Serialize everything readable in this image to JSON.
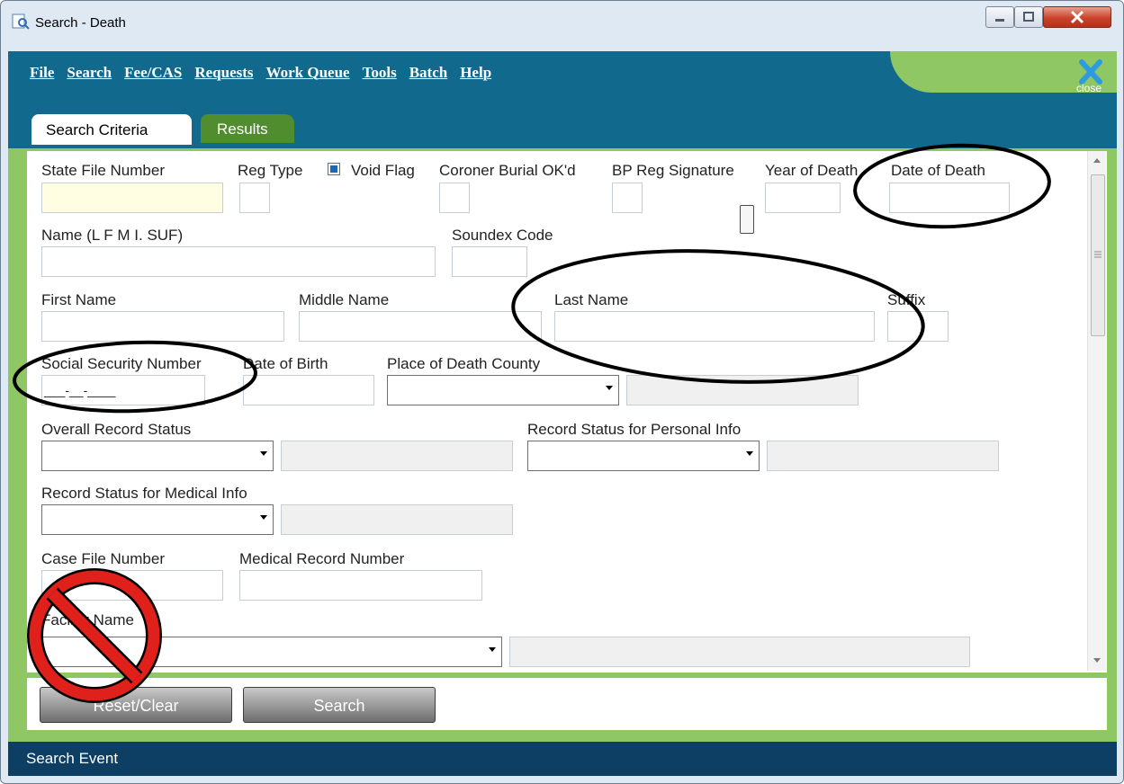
{
  "window": {
    "title": "Search - Death",
    "close_label": "close"
  },
  "menu": [
    {
      "label": "File"
    },
    {
      "label": "Search"
    },
    {
      "label": "Fee/CAS"
    },
    {
      "label": "Requests"
    },
    {
      "label": "Work Queue"
    },
    {
      "label": "Tools"
    },
    {
      "label": "Batch"
    },
    {
      "label": "Help"
    }
  ],
  "tabs": {
    "criteria": "Search Criteria",
    "results": "Results"
  },
  "form": {
    "state_file_number": "State File Number",
    "reg_type": "Reg Type",
    "void_flag": "Void Flag",
    "coroner_burial": "Coroner Burial OK'd",
    "bp_reg_signature": "BP Reg Signature",
    "year_of_death": "Year of Death",
    "date_of_death": "Date of Death",
    "name_full": "Name (L  F M I. SUF)",
    "soundex_code": "Soundex Code",
    "first_name": "First Name",
    "middle_name": "Middle Name",
    "last_name": "Last Name",
    "suffix": "Suffix",
    "ssn": "Social Security Number",
    "ssn_mask": "___-__-____",
    "date_of_birth": "Date of Birth",
    "place_of_death_county": "Place of Death County",
    "overall_record_status": "Overall Record Status",
    "record_status_personal": "Record Status for Personal Info",
    "record_status_medical": "Record Status for Medical Info",
    "case_file_number": "Case File Number",
    "medical_record_number": "Medical Record Number",
    "facility_name": "Facility Name"
  },
  "buttons": {
    "reset": "Reset/Clear",
    "search": "Search"
  },
  "status": {
    "text": "Search Event"
  },
  "colors": {
    "teal": "#11698e",
    "green": "#8fc765",
    "status": "#0c3f63",
    "prohibition": "#e0201b"
  }
}
